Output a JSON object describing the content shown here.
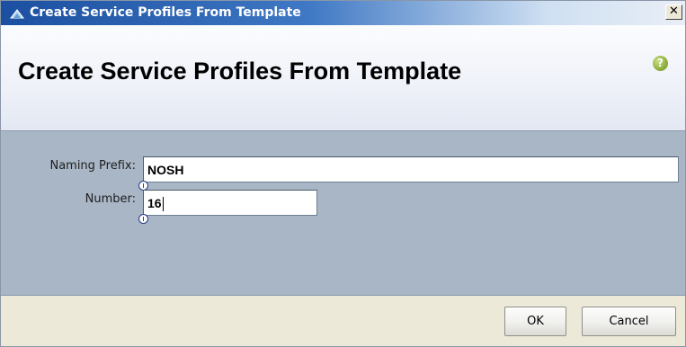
{
  "window": {
    "title": "Create Service Profiles From Template",
    "close_label": "✕"
  },
  "header": {
    "title": "Create Service Profiles From Template",
    "help_label": "?"
  },
  "form": {
    "naming_prefix": {
      "label": "Naming Prefix:",
      "value": "NOSH"
    },
    "number": {
      "label": "Number:",
      "value": "16"
    }
  },
  "footer": {
    "ok_label": "OK",
    "cancel_label": "Cancel"
  },
  "icons": {
    "app": "ucs-manager-icon",
    "help": "help-icon",
    "close": "close-icon",
    "marker": "info-marker-icon"
  },
  "colors": {
    "titlebar": "#1c4fa0",
    "content_bg": "#a9b6c6",
    "help_green": "#8fb03c",
    "footer_bg": "#ece9d8"
  }
}
